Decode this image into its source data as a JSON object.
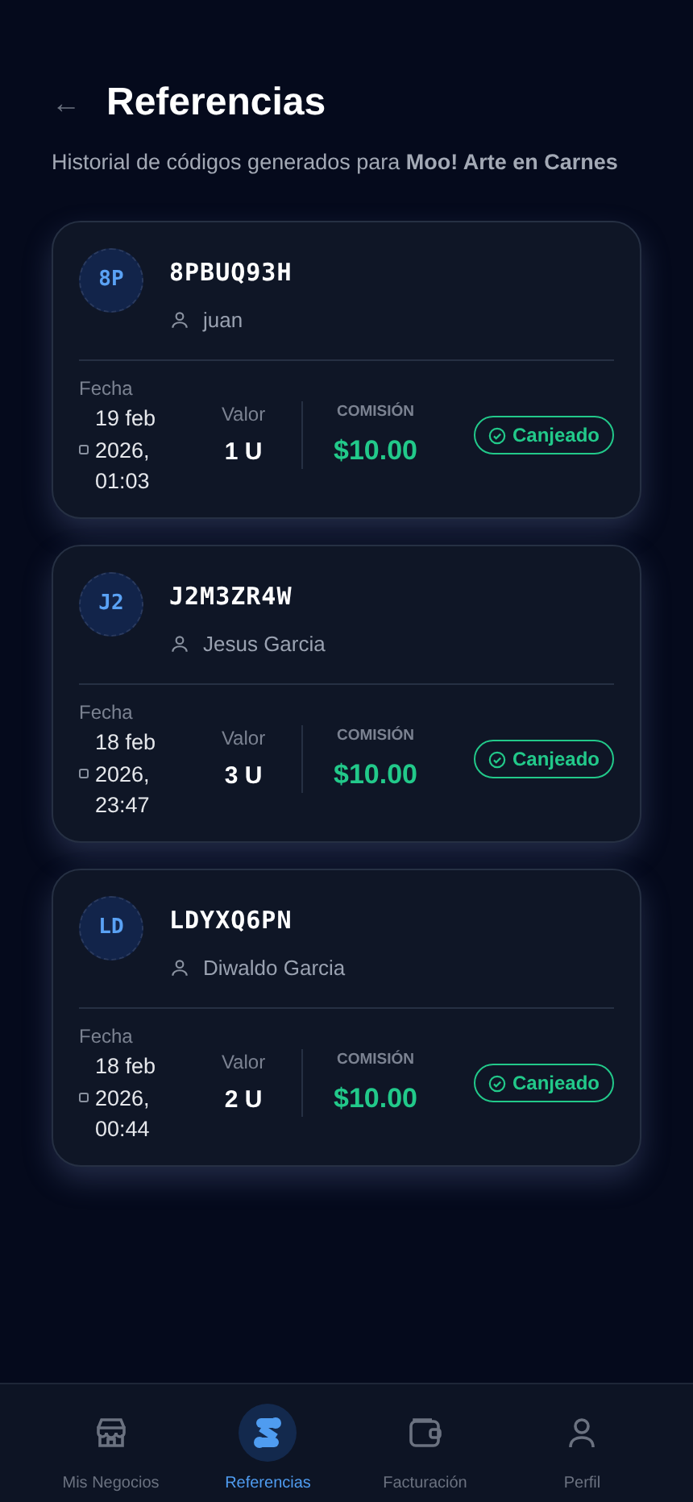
{
  "header": {
    "back": "←",
    "title": "Referencias",
    "subtitle": "Historial de códigos generados para **Moo! Arte en Carnes**"
  },
  "referrals": [
    {
      "initials": "8P",
      "code": "8PBUQ93H",
      "user": "juan",
      "date_label": "Fecha",
      "date": "19 feb 2026, 01:03",
      "value_label": "Valor",
      "value": "1 U",
      "commission_label": "COMISIÓN",
      "commission": "$10.00",
      "status": "Canjeado"
    },
    {
      "initials": "J2",
      "code": "J2M3ZR4W",
      "user": "Jesus Garcia",
      "date_label": "Fecha",
      "date": "18 feb 2026, 23:47",
      "value_label": "Valor",
      "value": "3 U",
      "commission_label": "COMISIÓN",
      "commission": "$10.00",
      "status": "Canjeado"
    },
    {
      "initials": "LD",
      "code": "LDYXQ6PN",
      "user": "Diwaldo Garcia",
      "date_label": "Fecha",
      "date": "18 feb 2026, 00:44",
      "value_label": "Valor",
      "value": "2 U",
      "commission_label": "COMISIÓN",
      "commission": "$10.00",
      "status": "Canjeado"
    }
  ],
  "bottom_nav": [
    {
      "label": "Mis Negocios",
      "kind": "store",
      "selected": false
    },
    {
      "label": "Referencias",
      "kind": "referrals",
      "selected": true
    },
    {
      "label": "Facturación",
      "kind": "wallet",
      "selected": false
    },
    {
      "label": "Perfil",
      "kind": "user",
      "selected": false
    }
  ]
}
